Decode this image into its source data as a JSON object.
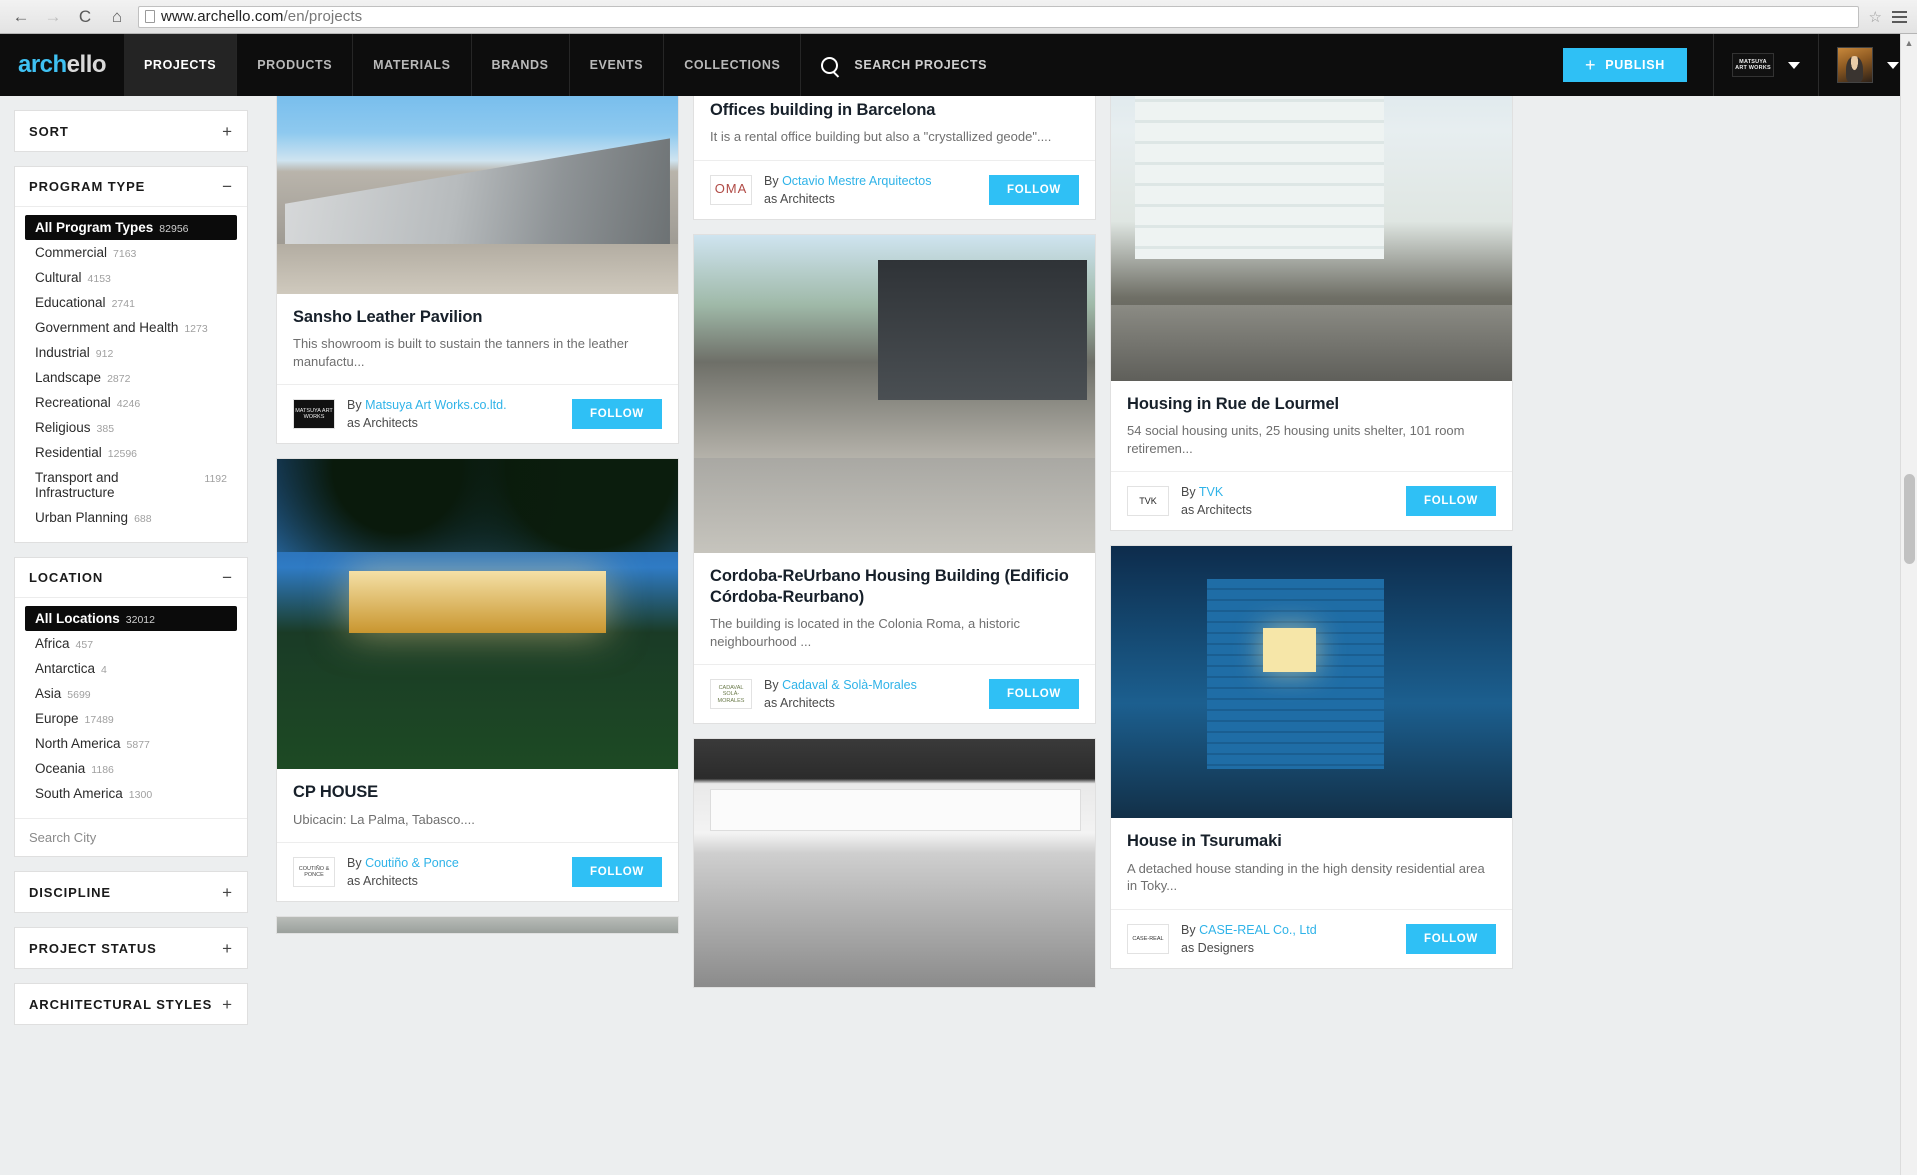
{
  "browser": {
    "back_icon": "←",
    "forward_icon": "→",
    "reload_icon": "C",
    "home_icon": "⌂",
    "url_protocol": "",
    "url_host": "www.archello.com",
    "url_path": "/en/projects",
    "star_icon": "☆",
    "menu_icon": "hamburger-menu"
  },
  "header": {
    "logo_part1": "arch",
    "logo_part2": "ello",
    "nav": [
      {
        "label": "PROJECTS",
        "active": true
      },
      {
        "label": "PRODUCTS",
        "active": false
      },
      {
        "label": "MATERIALS",
        "active": false
      },
      {
        "label": "BRANDS",
        "active": false
      },
      {
        "label": "EVENTS",
        "active": false
      },
      {
        "label": "COLLECTIONS",
        "active": false
      }
    ],
    "search_label": "SEARCH PROJECTS",
    "publish_label": "PUBLISH",
    "publish_plus": "+",
    "publish_color": "#2fc0f5",
    "brand_badge": "MATSUYA ART WORKS",
    "account_avatar": "user-avatar"
  },
  "sidebar": {
    "facets": [
      {
        "title": "SORT",
        "toggle": "+",
        "collapsed": true,
        "options": []
      },
      {
        "title": "PROGRAM TYPE",
        "toggle": "−",
        "collapsed": false,
        "options": [
          {
            "label": "All Program Types",
            "count": "82956",
            "selected": true
          },
          {
            "label": "Commercial",
            "count": "7163",
            "selected": false
          },
          {
            "label": "Cultural",
            "count": "4153",
            "selected": false
          },
          {
            "label": "Educational",
            "count": "2741",
            "selected": false
          },
          {
            "label": "Government and Health",
            "count": "1273",
            "selected": false
          },
          {
            "label": "Industrial",
            "count": "912",
            "selected": false
          },
          {
            "label": "Landscape",
            "count": "2872",
            "selected": false
          },
          {
            "label": "Recreational",
            "count": "4246",
            "selected": false
          },
          {
            "label": "Religious",
            "count": "385",
            "selected": false
          },
          {
            "label": "Residential",
            "count": "12596",
            "selected": false
          },
          {
            "label": "Transport and Infrastructure",
            "count": "1192",
            "selected": false
          },
          {
            "label": "Urban Planning",
            "count": "688",
            "selected": false
          }
        ]
      },
      {
        "title": "LOCATION",
        "toggle": "−",
        "collapsed": false,
        "options": [
          {
            "label": "All Locations",
            "count": "32012",
            "selected": true
          },
          {
            "label": "Africa",
            "count": "457",
            "selected": false
          },
          {
            "label": "Antarctica",
            "count": "4",
            "selected": false
          },
          {
            "label": "Asia",
            "count": "5699",
            "selected": false
          },
          {
            "label": "Europe",
            "count": "17489",
            "selected": false
          },
          {
            "label": "North America",
            "count": "5877",
            "selected": false
          },
          {
            "label": "Oceania",
            "count": "1186",
            "selected": false
          },
          {
            "label": "South America",
            "count": "1300",
            "selected": false
          }
        ],
        "city_search_placeholder": "Search City"
      },
      {
        "title": "DISCIPLINE",
        "toggle": "+",
        "collapsed": true,
        "options": []
      },
      {
        "title": "PROJECT STATUS",
        "toggle": "+",
        "collapsed": true,
        "options": []
      },
      {
        "title": "ARCHITECTURAL STYLES",
        "toggle": "+",
        "collapsed": true,
        "options": []
      }
    ]
  },
  "grid": {
    "follow_label": "FOLLOW",
    "by_label": "By",
    "columns": [
      {
        "cards": [
          {
            "id": "sansho",
            "title": "Sansho Leather Pavilion",
            "desc": "This showroom is built to sustain the tanners in the leather manufactu...",
            "author": "Matsuya Art Works.co.ltd.",
            "role": "as Architects",
            "logo_text": "MATSUYA ART WORKS",
            "follow": "FOLLOW"
          },
          {
            "id": "cphouse",
            "title": "CP HOUSE",
            "desc": "Ubicacin: La Palma, Tabasco....",
            "author": "Coutiño & Ponce",
            "role": "as Architects",
            "logo_text": "COUTIÑO & PONCE",
            "follow": "FOLLOW"
          }
        ]
      },
      {
        "cards": [
          {
            "id": "offices-barcelona",
            "title": "Offices building in Barcelona",
            "desc": "It is a rental office building but also a \"crystallized geode\"....",
            "author": "Octavio Mestre Arquitectos",
            "role": "as Architects",
            "logo_text": "OMA",
            "follow": "FOLLOW"
          },
          {
            "id": "cordoba-reurbano",
            "title": "Cordoba-ReUrbano Housing Building (Edificio Córdoba-Reurbano)",
            "desc": "The building is located in the Colonia Roma, a historic neighbourhood ...",
            "author": "Cadaval & Solà-Morales",
            "role": "as Architects",
            "logo_text": "CADAVAL SOLÀ-MORALES",
            "follow": "FOLLOW"
          },
          {
            "id": "latonta-cafe",
            "title": "",
            "desc": "",
            "author": "",
            "role": "",
            "logo_text": "",
            "follow": ""
          }
        ]
      },
      {
        "cards": [
          {
            "id": "rue-de-lourmel",
            "title": "Housing in Rue de Lourmel",
            "desc": "54 social housing units, 25 housing units shelter, 101 room retiremen...",
            "author": "TVK",
            "role": "as Architects",
            "logo_text": "TVK",
            "follow": "FOLLOW"
          },
          {
            "id": "house-tsurumaki",
            "title": "House in Tsurumaki",
            "desc": "A detached house standing in the high density residential area in Toky...",
            "author": "CASE-REAL Co., Ltd",
            "role": "as Designers",
            "logo_text": "CASE-REAL",
            "follow": "FOLLOW"
          }
        ]
      }
    ]
  },
  "scrollbar": {
    "up_arrow": "▲",
    "down_arrow": "▼"
  }
}
